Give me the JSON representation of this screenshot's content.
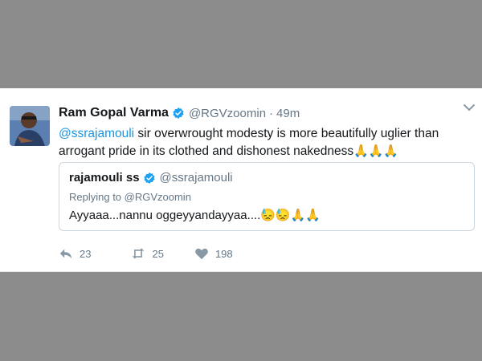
{
  "tweet": {
    "author_name": "Ram Gopal Varma",
    "author_handle": "@RGVzoomin",
    "separator": "·",
    "time": "49m",
    "text_mention": "@ssrajamouli",
    "text_body": " sir overwrought modesty is more beautifully uglier than arrogant pride in its clothed and dishonest nakedness",
    "text_emoji": "🙏🙏🙏"
  },
  "quoted": {
    "author_name": "rajamouli ss",
    "author_handle": "@ssrajamouli",
    "replying_to": "Replying to @RGVzoomin",
    "text": "Ayyaaa...nannu oggeyyandayyaa....",
    "text_emoji": "😓😓🙏🙏"
  },
  "actions": {
    "reply_count": "23",
    "retweet_count": "25",
    "like_count": "198"
  },
  "colors": {
    "link": "#1b95e0",
    "verified": "#1da1f2",
    "muted": "#657786",
    "background": "#8c8c8c"
  },
  "icons": [
    "verified-badge-icon",
    "chevron-down-icon",
    "reply-icon",
    "retweet-icon",
    "heart-icon"
  ]
}
